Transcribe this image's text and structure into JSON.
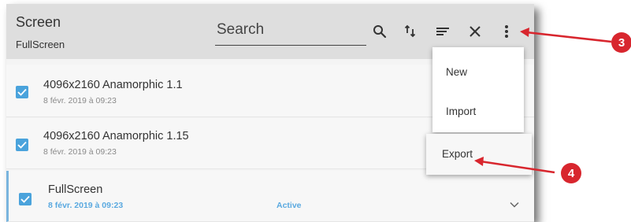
{
  "header": {
    "title": "Screen",
    "subtitle": "FullScreen",
    "search_placeholder": "Search",
    "icons": [
      "search-icon",
      "sort-icon",
      "filter-icon",
      "close-icon",
      "more-vert-icon"
    ]
  },
  "list": {
    "items": [
      {
        "title": "4096x2160 Anamorphic 1.1",
        "date": "8 févr. 2019 à 09:23",
        "checked": true
      },
      {
        "title": "4096x2160 Anamorphic 1.15",
        "date": "8 févr. 2019 à 09:23",
        "checked": true
      },
      {
        "title": "FullScreen",
        "date": "8 févr. 2019 à 09:23",
        "status": "Active",
        "checked": true
      }
    ]
  },
  "menu": {
    "items": [
      {
        "label": "New"
      },
      {
        "label": "Import"
      },
      {
        "label": "Export"
      }
    ]
  },
  "callouts": [
    "3",
    "4"
  ],
  "colors": {
    "accent": "#4aa3dc",
    "callout": "#d8262e",
    "header_bg": "#dedede"
  }
}
